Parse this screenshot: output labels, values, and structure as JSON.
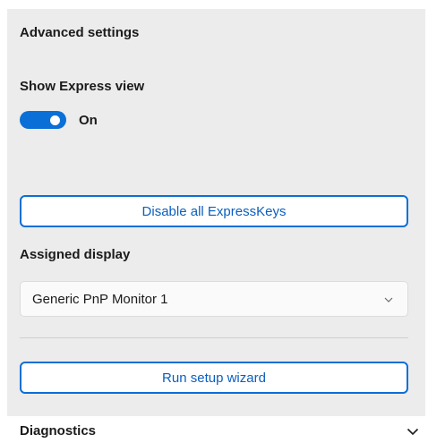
{
  "advanced_settings": {
    "title": "Advanced settings",
    "express_view": {
      "label": "Show Express view",
      "toggle_state": "On",
      "enabled": true
    },
    "disable_expresskeys_label": "Disable all ExpressKeys",
    "assigned_display": {
      "label": "Assigned display",
      "selected": "Generic PnP Monitor 1"
    },
    "run_setup_wizard_label": "Run setup wizard"
  },
  "diagnostics": {
    "title": "Diagnostics",
    "expanded": false
  },
  "colors": {
    "accent": "#0a6fd6",
    "panel_background": "#ececec"
  },
  "icons": [
    "chevron-down-icon",
    "chevron-down-icon"
  ]
}
